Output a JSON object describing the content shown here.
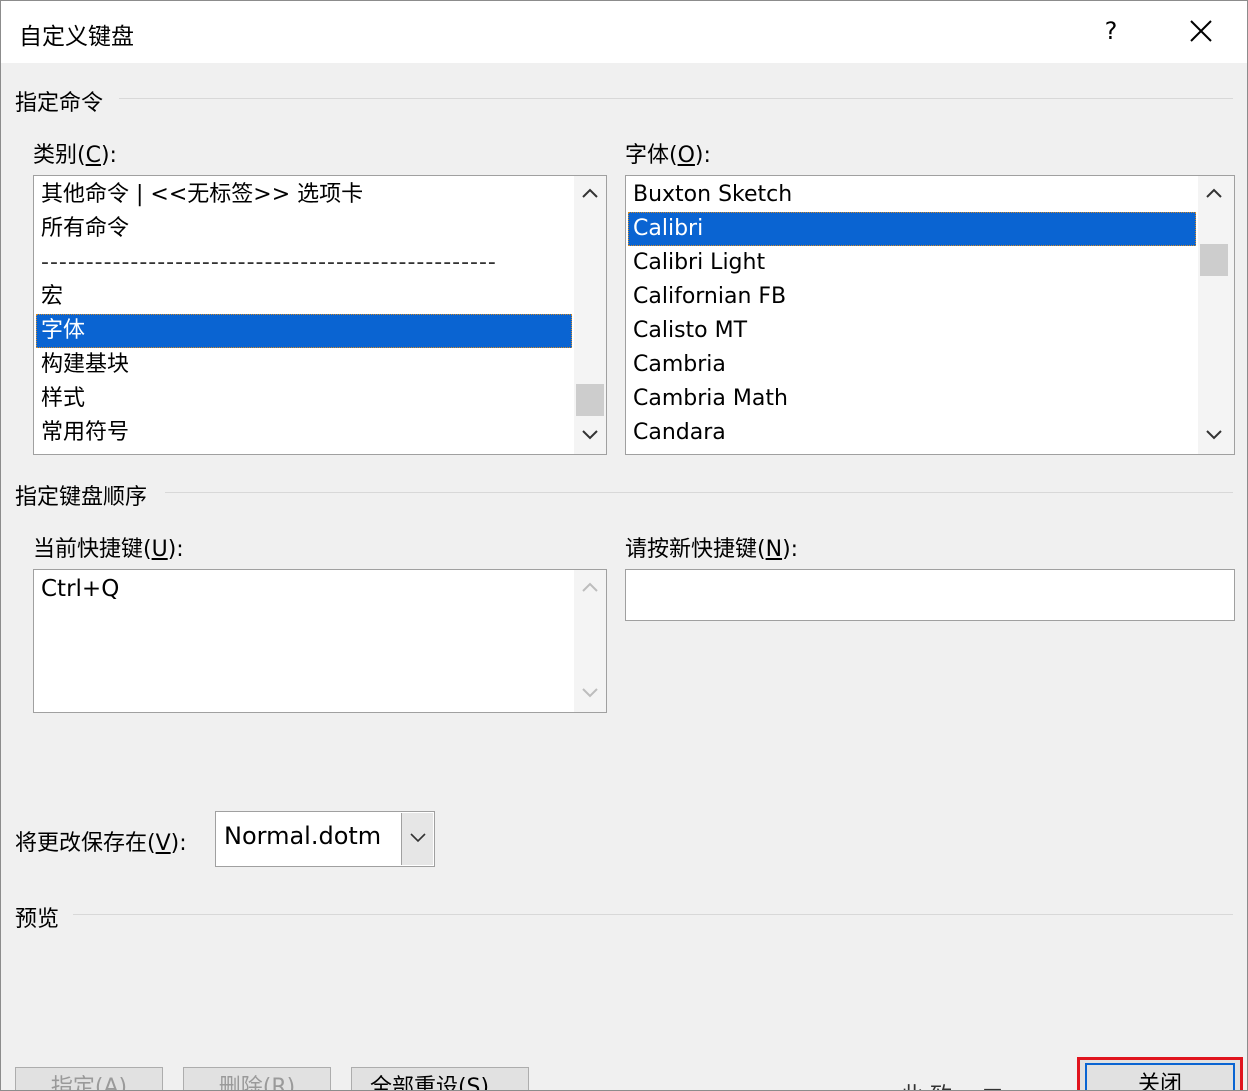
{
  "window": {
    "title": "自定义键盘",
    "help_label": "?"
  },
  "assign_commands": {
    "group_label": "指定命令",
    "categories": {
      "label_main": "类别(",
      "label_key": "C",
      "label_end": "):",
      "items": [
        "其他命令 | <<无标签>> 选项卡",
        "所有命令",
        "---------------------------------------------------",
        "宏",
        "字体",
        "构建基块",
        "样式",
        "常用符号"
      ],
      "selected": "字体"
    },
    "fonts": {
      "label_main": "字体(",
      "label_key": "O",
      "label_end": "):",
      "items": [
        "Buxton Sketch",
        "Calibri",
        "Calibri Light",
        "Californian FB",
        "Calisto MT",
        "Cambria",
        "Cambria Math",
        "Candara"
      ],
      "selected": "Calibri"
    }
  },
  "keyboard_sequence": {
    "group_label": "指定键盘顺序",
    "current_keys": {
      "label_main": "当前快捷键(",
      "label_key": "U",
      "label_end": "):",
      "values": [
        "Ctrl+Q"
      ]
    },
    "new_key": {
      "label_main": "请按新快捷键(",
      "label_key": "N",
      "label_end": "):",
      "value": ""
    }
  },
  "save_in": {
    "label_main": "将更改保存在(",
    "label_key": "V",
    "label_end": "):",
    "value": "Normal.dotm"
  },
  "preview": {
    "group_label": "预览"
  },
  "buttons": {
    "assign": "指定(A)",
    "remove": "删除(R)",
    "reset_all": "全部重设(S)...",
    "partial_text": "此 致 ∩ □",
    "close": "关闭"
  },
  "colors": {
    "selection": "#0a64d2",
    "highlight_border": "#e0141e"
  }
}
